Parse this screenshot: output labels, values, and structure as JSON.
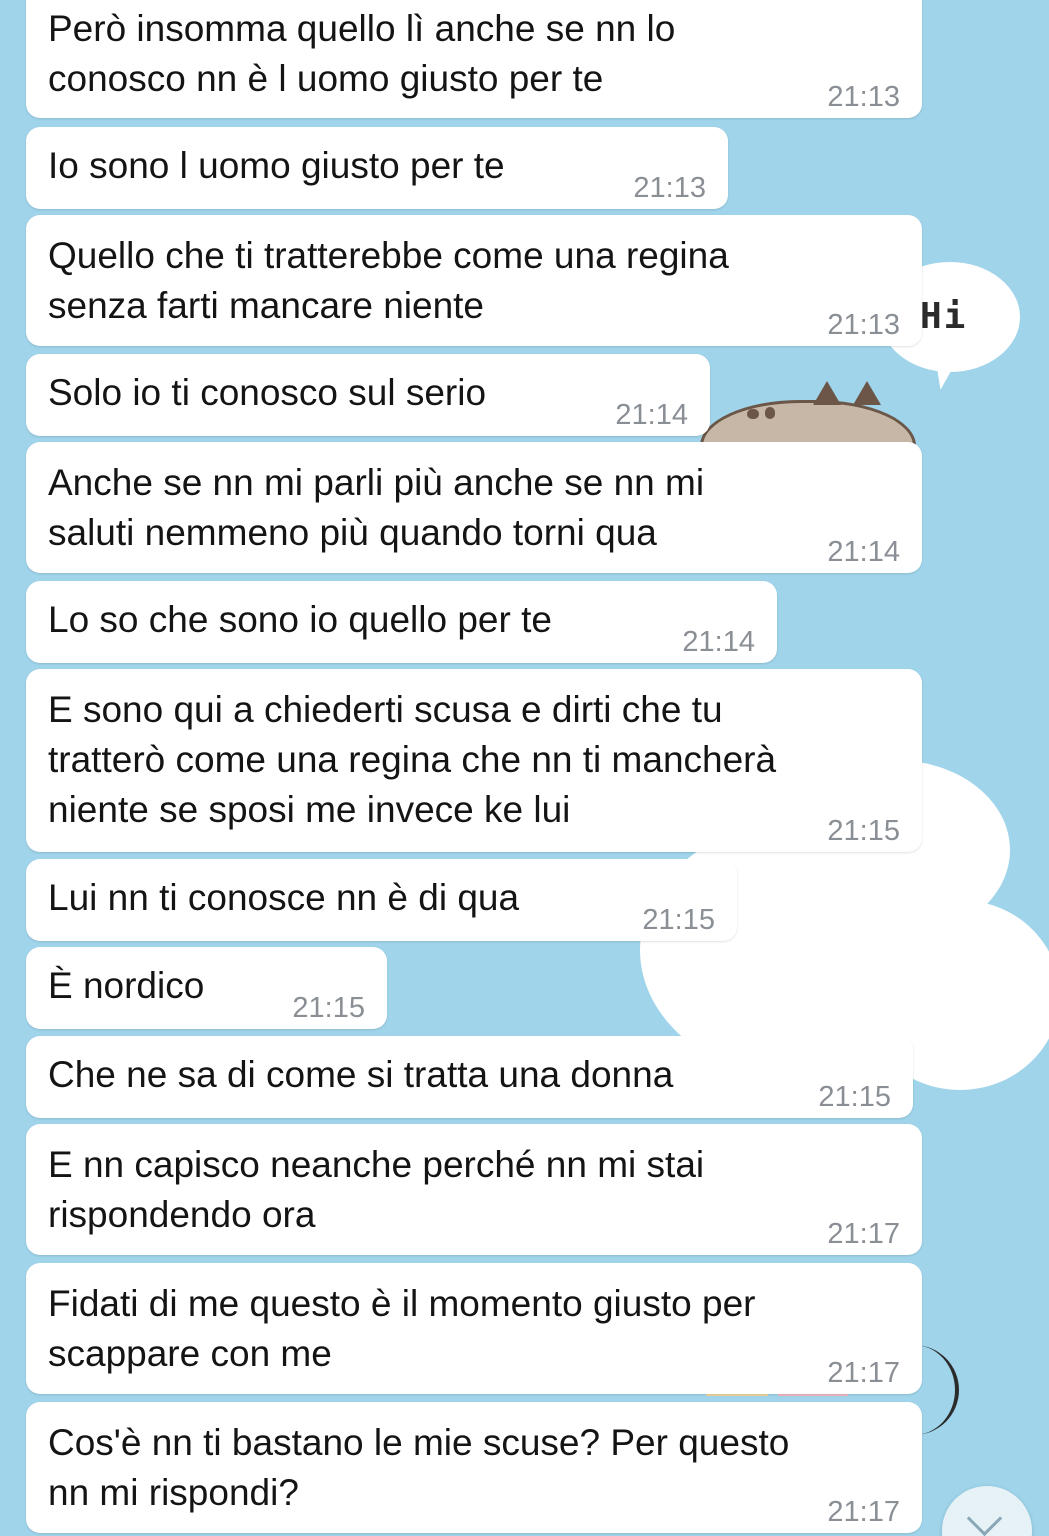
{
  "theme": {
    "wallpaper_color": "#9fd4ea",
    "bubble_color": "#ffffff",
    "text_color": "#141414",
    "time_color": "#8a8f95"
  },
  "wallpaper": {
    "hi_text": "Hi"
  },
  "messages": [
    {
      "lines": [
        "Però insomma quello lì anche se nn lo",
        "conosco nn è l uomo giusto per te"
      ],
      "time": "21:13"
    },
    {
      "lines": [
        "Io sono l uomo giusto per te"
      ],
      "time": "21:13"
    },
    {
      "lines": [
        "Quello che ti tratterebbe come una regina",
        "senza farti mancare niente"
      ],
      "time": "21:13"
    },
    {
      "lines": [
        "Solo io ti conosco sul serio"
      ],
      "time": "21:14"
    },
    {
      "lines": [
        "Anche se nn mi parli più anche se nn mi",
        "saluti nemmeno più quando torni qua"
      ],
      "time": "21:14"
    },
    {
      "lines": [
        "Lo so che sono io quello per te"
      ],
      "time": "21:14"
    },
    {
      "lines": [
        "E sono qui a chiederti scusa e dirti che tu",
        "tratterò come una regina che nn ti mancherà",
        "niente se sposi me invece ke lui"
      ],
      "time": "21:15"
    },
    {
      "lines": [
        "Lui nn ti conosce nn è di qua"
      ],
      "time": "21:15"
    },
    {
      "lines": [
        "È nordico"
      ],
      "time": "21:15"
    },
    {
      "lines": [
        "Che ne sa di come si tratta una donna"
      ],
      "time": "21:15"
    },
    {
      "lines": [
        "E nn capisco neanche perché nn mi stai",
        "rispondendo ora"
      ],
      "time": "21:17"
    },
    {
      "lines": [
        "Fidati di me questo è il momento giusto per",
        "scappare con me"
      ],
      "time": "21:17"
    },
    {
      "lines": [
        "Cos'è nn ti bastano le mie scuse? Per questo",
        "nn mi rispondi?"
      ],
      "time": "21:17"
    }
  ]
}
